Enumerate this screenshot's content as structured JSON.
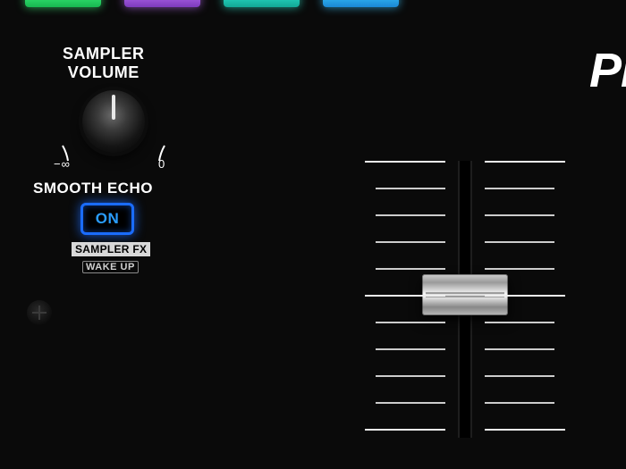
{
  "brand_partial": "Pi",
  "pads": [
    {
      "color": "green"
    },
    {
      "color": "purple"
    },
    {
      "color": "teal"
    },
    {
      "color": "blue"
    }
  ],
  "sampler_volume": {
    "label_line1": "SAMPLER",
    "label_line2": "VOLUME",
    "range_min_symbol": "−∞",
    "range_max_symbol": "0",
    "knob_position_deg": 0
  },
  "smooth_echo": {
    "label": "SMOOTH ECHO",
    "on_button_text": "ON",
    "on_button_lit": true,
    "sub_label_1": "SAMPLER FX",
    "sub_label_2": "WAKE UP"
  },
  "fader": {
    "tick_count": 11,
    "major_tick_indices": [
      0,
      5,
      10
    ],
    "cap_position_index": 5
  }
}
